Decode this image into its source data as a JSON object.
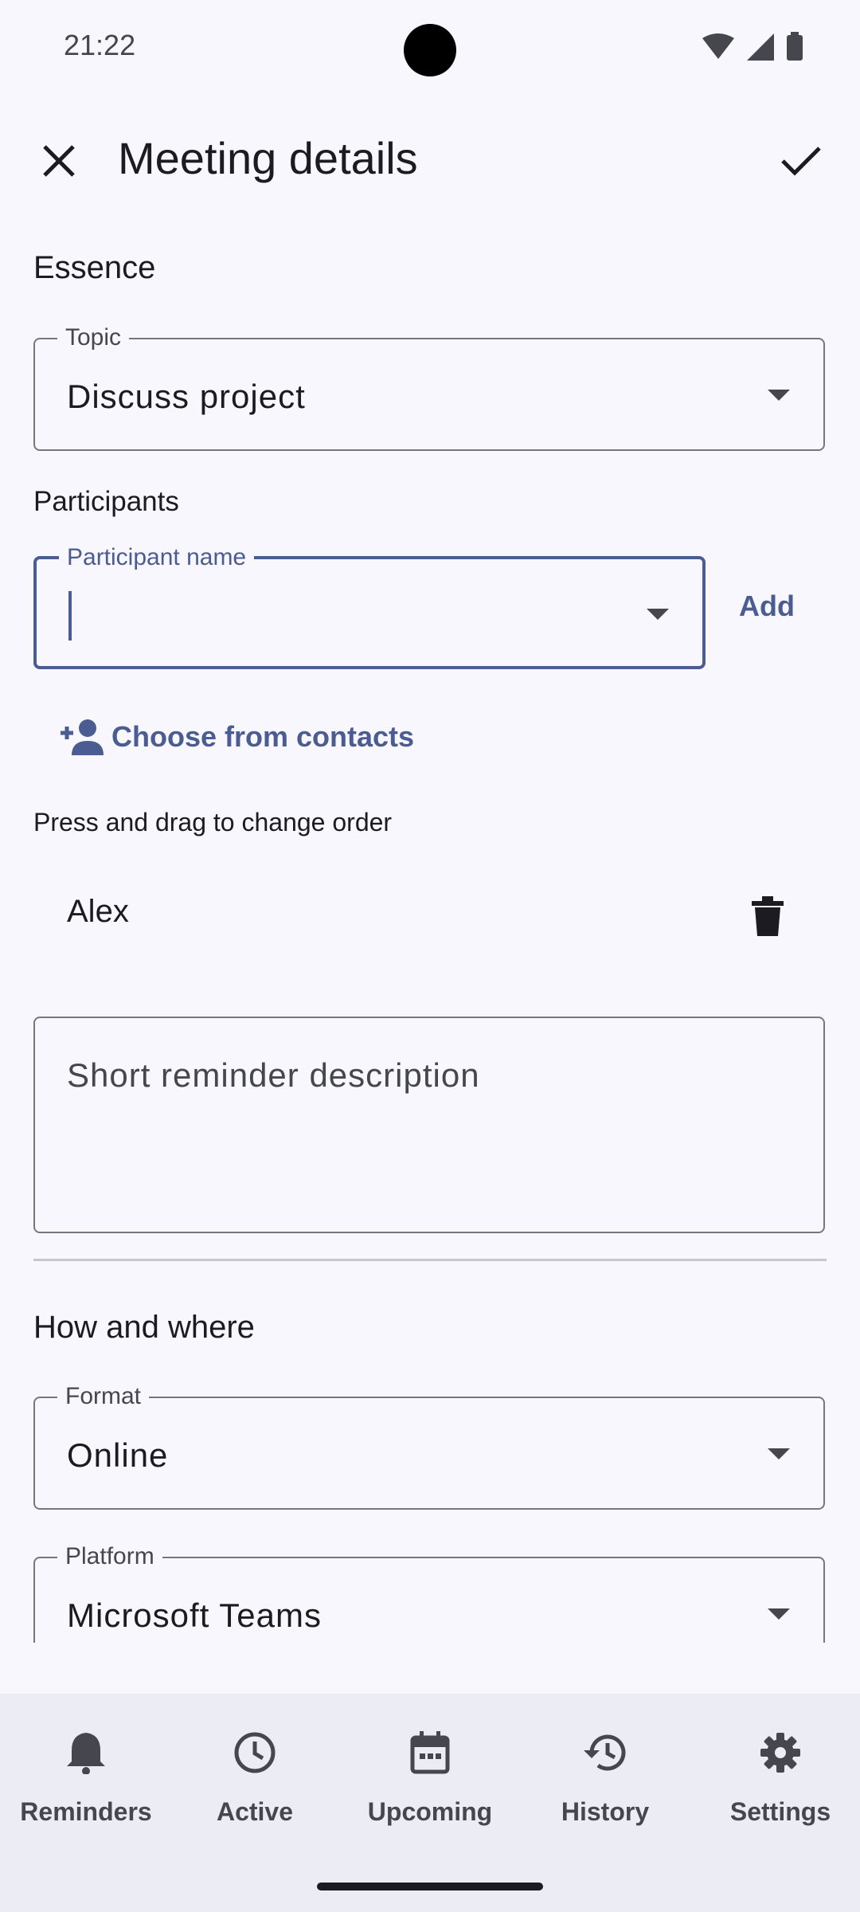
{
  "status_bar": {
    "time": "21:22"
  },
  "app_bar": {
    "title": "Meeting details",
    "close_icon": "close-icon",
    "confirm_icon": "check-icon"
  },
  "essence": {
    "title": "Essence",
    "topic": {
      "label": "Topic",
      "value": "Discuss project"
    }
  },
  "participants": {
    "title": "Participants",
    "name_field": {
      "label": "Participant name",
      "value": ""
    },
    "add_label": "Add",
    "choose_contacts_label": "Choose from contacts",
    "hint": "Press and drag to change order",
    "items": [
      {
        "name": "Alex"
      }
    ]
  },
  "description": {
    "placeholder": "Short reminder description",
    "value": ""
  },
  "how_where": {
    "title": "How and where",
    "format": {
      "label": "Format",
      "value": "Online"
    },
    "platform": {
      "label": "Platform",
      "value": "Microsoft Teams"
    }
  },
  "bottom_nav": {
    "items": [
      {
        "label": "Reminders",
        "icon": "bell-icon"
      },
      {
        "label": "Active",
        "icon": "clock-icon"
      },
      {
        "label": "Upcoming",
        "icon": "calendar-icon"
      },
      {
        "label": "History",
        "icon": "history-icon"
      },
      {
        "label": "Settings",
        "icon": "gear-icon"
      }
    ]
  },
  "colors": {
    "accent": "#4a5c92",
    "background": "#f8f7fd",
    "nav_background": "#ececf4"
  }
}
